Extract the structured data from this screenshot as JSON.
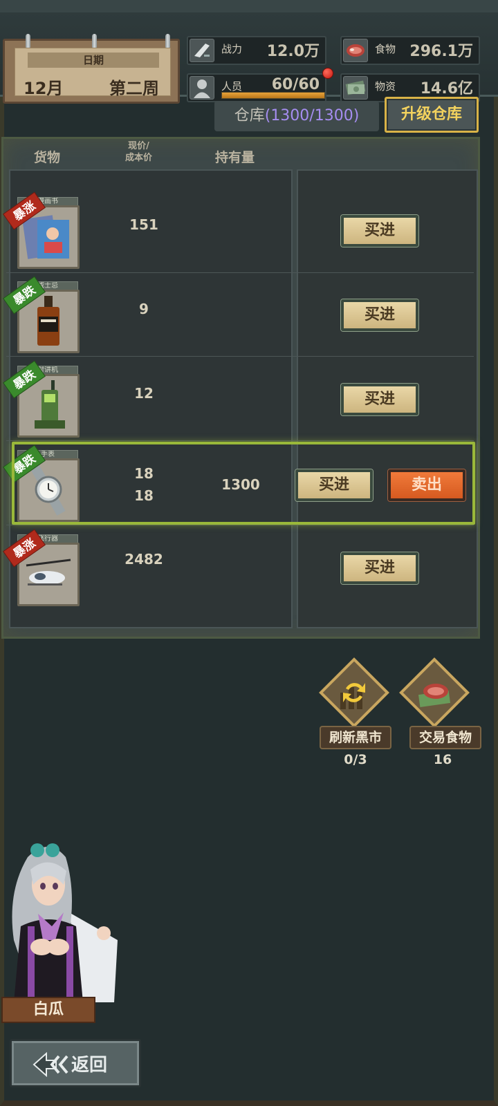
{
  "header": {
    "date_label": "日期",
    "month": "12月",
    "week": "第二周",
    "power": {
      "label": "战力",
      "value": "12.0万"
    },
    "staff": {
      "label": "人员",
      "value": "60/60",
      "fill": 1.0
    },
    "food": {
      "label": "食物",
      "value": "296.1万"
    },
    "supplies": {
      "label": "物资",
      "value": "14.6亿"
    }
  },
  "warehouse": {
    "label": "仓库",
    "open": "(",
    "count": "1300/1300",
    "close": ")",
    "upgrade_label": "升级仓库"
  },
  "market": {
    "columns": {
      "goods": "货物",
      "price_line1": "现价/",
      "price_line2": "成本价",
      "holding": "持有量"
    },
    "items": [
      {
        "tag": "漫画书",
        "trend": "暴涨",
        "trend_dir": "up",
        "price": "151",
        "cost": "",
        "holding": "",
        "buy": "买进",
        "sell": ""
      },
      {
        "tag": "威士忌",
        "trend": "暴跌",
        "trend_dir": "down",
        "price": "9",
        "cost": "",
        "holding": "",
        "buy": "买进",
        "sell": ""
      },
      {
        "tag": "对讲机",
        "trend": "暴跌",
        "trend_dir": "down",
        "price": "12",
        "cost": "",
        "holding": "",
        "buy": "买进",
        "sell": ""
      },
      {
        "tag": "手表",
        "trend": "暴跌",
        "trend_dir": "down",
        "price": "18",
        "cost": "18",
        "holding": "1300",
        "buy": "买进",
        "sell": "卖出"
      },
      {
        "tag": "飞行器",
        "trend": "暴涨",
        "trend_dir": "up",
        "price": "2482",
        "cost": "",
        "holding": "",
        "buy": "买进",
        "sell": ""
      }
    ]
  },
  "actions": {
    "refresh": {
      "label": "刷新黑市",
      "count": "0/3"
    },
    "trade_food": {
      "label": "交易食物",
      "count": "16"
    }
  },
  "npc": {
    "name": "白瓜"
  },
  "back_label": "返回"
}
